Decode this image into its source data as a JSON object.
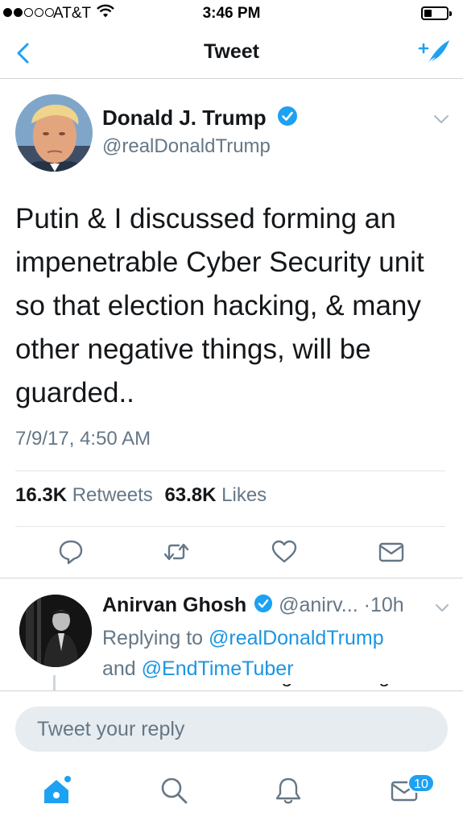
{
  "status_bar": {
    "carrier": "AT&T",
    "time": "3:46 PM"
  },
  "nav": {
    "title": "Tweet"
  },
  "tweet": {
    "author_name": "Donald J. Trump",
    "author_handle": "@realDonaldTrump",
    "text": "Putin & I discussed forming an impenetrable Cyber Security unit so that election hacking, & many other negative things, will be guarded..",
    "timestamp": "7/9/17, 4:50 AM",
    "retweets_count": "16.3K",
    "retweets_label": "Retweets",
    "likes_count": "63.8K",
    "likes_label": "Likes"
  },
  "reply": {
    "author_name": "Anirvan Ghosh",
    "author_handle": "@anirv...",
    "time": "10h",
    "replying_prefix": "Replying to",
    "replying_user_1": "@realDonaldTrump",
    "replying_and": "and",
    "replying_user_2": "@EndTimeTuber",
    "text_cut": "Putin was also willing to take flight"
  },
  "composer": {
    "placeholder": "Tweet your reply"
  },
  "tabs": {
    "messages_badge": "10"
  },
  "colors": {
    "accent": "#1da1f2",
    "verified": "#1da1f2",
    "text": "#14171a",
    "secondary": "#657786"
  }
}
